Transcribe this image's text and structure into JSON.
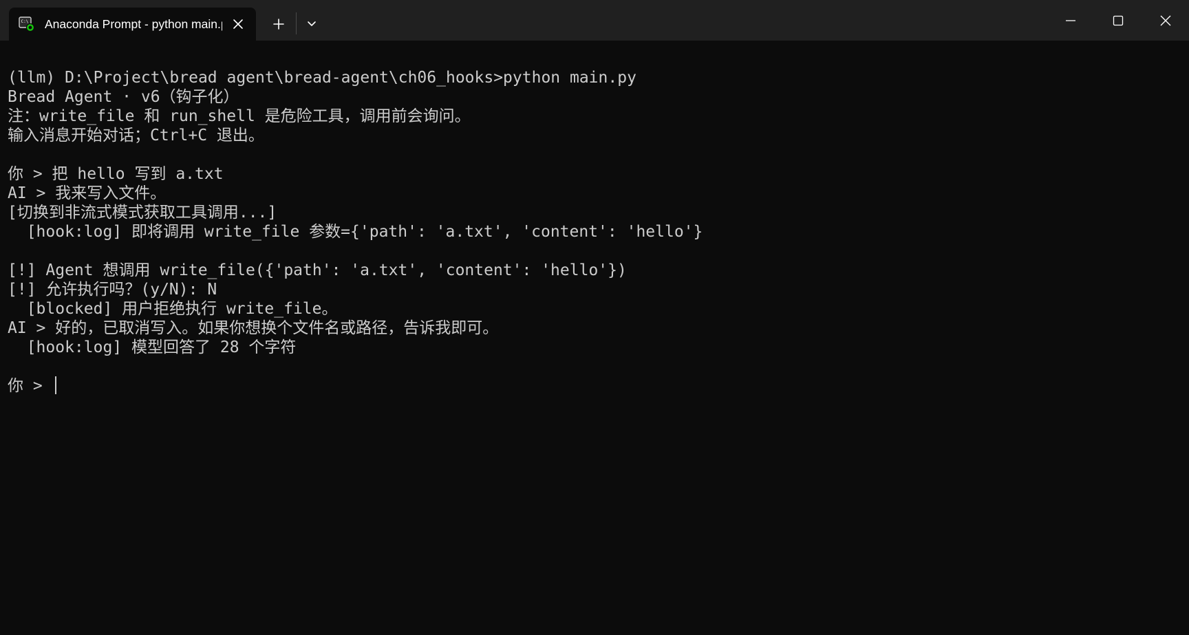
{
  "window": {
    "tab_title": "Anaconda Prompt - python  main.py",
    "icons": {
      "tab": "terminal-icon",
      "tab_close": "close-icon",
      "new_tab": "plus-icon",
      "dropdown": "chevron-down-icon",
      "minimize": "minimize-icon",
      "maximize": "maximize-icon",
      "close": "close-icon"
    },
    "colors": {
      "titlebar": "#202020",
      "background": "#0c0c0c",
      "text": "#cccccc",
      "tab_icon_accent": "#16c60c"
    }
  },
  "console": {
    "lines": [
      "(llm) D:\\Project\\bread agent\\bread-agent\\ch06_hooks>python main.py",
      "Bread Agent · v6（钩子化）",
      "注：write_file 和 run_shell 是危险工具，调用前会询问。",
      "输入消息开始对话；Ctrl+C 退出。",
      "",
      "你 > 把 hello 写到 a.txt",
      "AI > 我来写入文件。",
      "[切换到非流式模式获取工具调用...]",
      "  [hook:log] 即将调用 write_file 参数={'path': 'a.txt', 'content': 'hello'}",
      "",
      "[!] Agent 想调用 write_file({'path': 'a.txt', 'content': 'hello'})",
      "[!] 允许执行吗？(y/N): N",
      "  [blocked] 用户拒绝执行 write_file。",
      "AI > 好的，已取消写入。如果你想换个文件名或路径，告诉我即可。",
      "  [hook:log] 模型回答了 28 个字符",
      ""
    ],
    "prompt": "你 > "
  }
}
